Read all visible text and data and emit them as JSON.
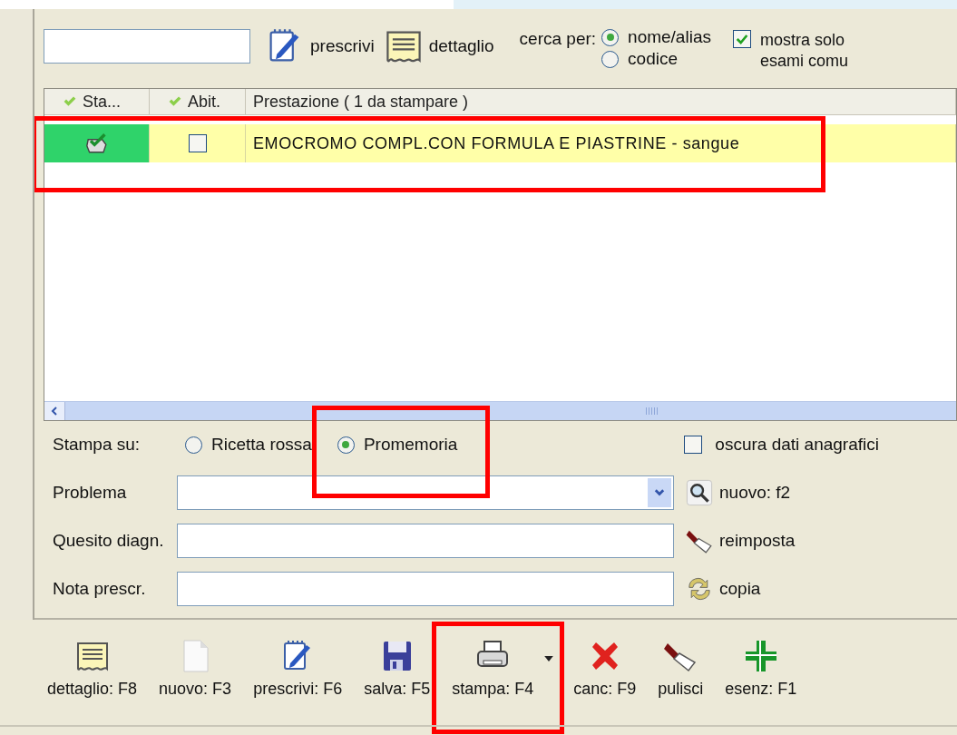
{
  "search_actions": [
    {
      "kind": "prescribe",
      "label": "prescrivi"
    },
    {
      "kind": "detail",
      "label": "dettaglio"
    }
  ],
  "search_by": {
    "label": "cerca per:",
    "options": [
      {
        "label": "nome/alias",
        "selected": true
      },
      {
        "label": "codice",
        "selected": false
      }
    ]
  },
  "only_common": {
    "label": "mostra solo esami comu",
    "checked": true
  },
  "table": {
    "columns": [
      "Sta...",
      "Abit.",
      "Prestazione ( 1 da stampare )"
    ],
    "rows": [
      {
        "kind": "done",
        "abit_checked": false,
        "name": "EMOCROMO COMPL.CON FORMULA E PIASTRINE - sangue",
        "highlighted": true
      }
    ]
  },
  "print_on": {
    "label": "Stampa su:",
    "options": [
      {
        "label": "Ricetta rossa",
        "selected": false,
        "highlighted": false
      },
      {
        "label": "Promemoria",
        "selected": true,
        "highlighted": true
      }
    ]
  },
  "hide_personal": {
    "label": "oscura dati anagrafici",
    "checked": false
  },
  "fields": [
    {
      "kind": "dropdown",
      "label": "Problema",
      "action": {
        "kind": "search",
        "label": "nuovo: f2"
      }
    },
    {
      "kind": "text",
      "label": "Quesito diagn.",
      "action": {
        "kind": "reset",
        "label": "reimposta"
      }
    },
    {
      "kind": "text",
      "label": "Nota prescr.",
      "action": {
        "kind": "copy",
        "label": "copia"
      }
    }
  ],
  "toolbar": [
    {
      "kind": "detail",
      "label": "dettaglio: F8",
      "has_menu": false,
      "highlighted": false
    },
    {
      "kind": "new",
      "label": "nuovo: F3",
      "has_menu": false,
      "highlighted": false
    },
    {
      "kind": "prescribe",
      "label": "prescrivi: F6",
      "has_menu": false,
      "highlighted": false
    },
    {
      "kind": "save",
      "label": "salva: F5",
      "has_menu": false,
      "highlighted": false
    },
    {
      "kind": "print",
      "label": "stampa: F4",
      "has_menu": true,
      "highlighted": true
    },
    {
      "kind": "delete",
      "label": "canc: F9",
      "has_menu": false,
      "highlighted": false
    },
    {
      "kind": "clear",
      "label": "pulisci",
      "has_menu": false,
      "highlighted": false
    },
    {
      "kind": "exemption",
      "label": "esenz: F1",
      "has_menu": false,
      "highlighted": false
    }
  ]
}
